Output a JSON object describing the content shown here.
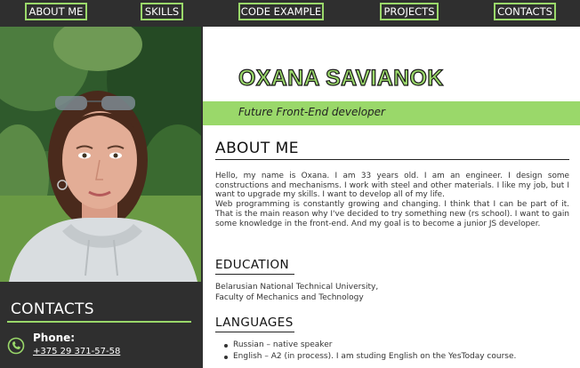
{
  "nav": {
    "items": [
      {
        "label": "ABOUT ME"
      },
      {
        "label": "SKILLS"
      },
      {
        "label": "CODE EXAMPLE"
      },
      {
        "label": "PROJECTS"
      },
      {
        "label": "CONTACTS"
      }
    ]
  },
  "colors": {
    "accent": "#9ad86a",
    "dark_panel": "#2f2f2f"
  },
  "header": {
    "name": "OXANA SAVIANOK",
    "subtitle": "Future Front-End developer"
  },
  "sidebar": {
    "contacts_title": "CONTACTS",
    "phone_icon": "phone-icon",
    "phone_label": "Phone:",
    "phone_number": "+375 29 371-57-58"
  },
  "about": {
    "title": "ABOUT ME",
    "paragraph_1": "Hello, my name is Oxana. I am 33 years old. I am an engineer. I design some constructions and mechanisms. I work with steel and other materials. I like my job, but I want to upgrade my skills. I want to develop all of my life.",
    "paragraph_2": "Web programming is constantly growing and changing. I think that I can be part of it. That is the main reason why I've decided to try something new (rs school). I want to gain some knowledge in the front-end. And my goal is to become a junior JS developer."
  },
  "education": {
    "title": "EDUCATION",
    "line_1": "Belarusian National Technical University,",
    "line_2": "Faculty of Mechanics and Technology"
  },
  "languages": {
    "title": "LANGUAGES",
    "items": [
      {
        "text": "Russian – native speaker"
      },
      {
        "text": "English – A2 (in process). I am studing English on the YesToday course."
      }
    ]
  }
}
